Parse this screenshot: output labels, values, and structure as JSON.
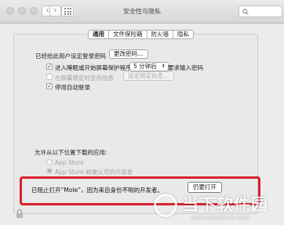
{
  "window": {
    "title": "安全性与隐私",
    "nav_back": "‹",
    "nav_forward": "›"
  },
  "tabs": [
    {
      "label": "通用",
      "active": true
    },
    {
      "label": "文件保险箱",
      "active": false
    },
    {
      "label": "防火墙",
      "active": false
    },
    {
      "label": "隐私",
      "active": false
    }
  ],
  "general": {
    "password_set_label": "已经给此用户设定登录密码",
    "change_password_button": "更改密码…",
    "require_password": {
      "checked": "✓",
      "label_before": "进入睡眠或开始屏幕保护程序",
      "delay_value": "5 分钟后",
      "label_after": "要求输入密码"
    },
    "show_message": {
      "label": "在屏幕锁定时显示信息",
      "button": "设定锁定信息…"
    },
    "disable_autologin": {
      "checked": "✓",
      "label": "停用自动登录"
    }
  },
  "downloads": {
    "heading": "允许从以下位置下载的应用:",
    "options": [
      {
        "label": "App Store",
        "selected": false
      },
      {
        "label": "App Store 和被认可的开发者",
        "selected": true
      }
    ],
    "blocked_message": "已阻止打开“Mole”，因为来自身份不明的开发者。",
    "open_anyway_button": "仍要打开"
  },
  "watermark": {
    "brand": "当下软件园",
    "url": "www.downxia.com"
  },
  "colors": {
    "highlight_border": "#d7232c",
    "window_bg": "#ececec"
  }
}
